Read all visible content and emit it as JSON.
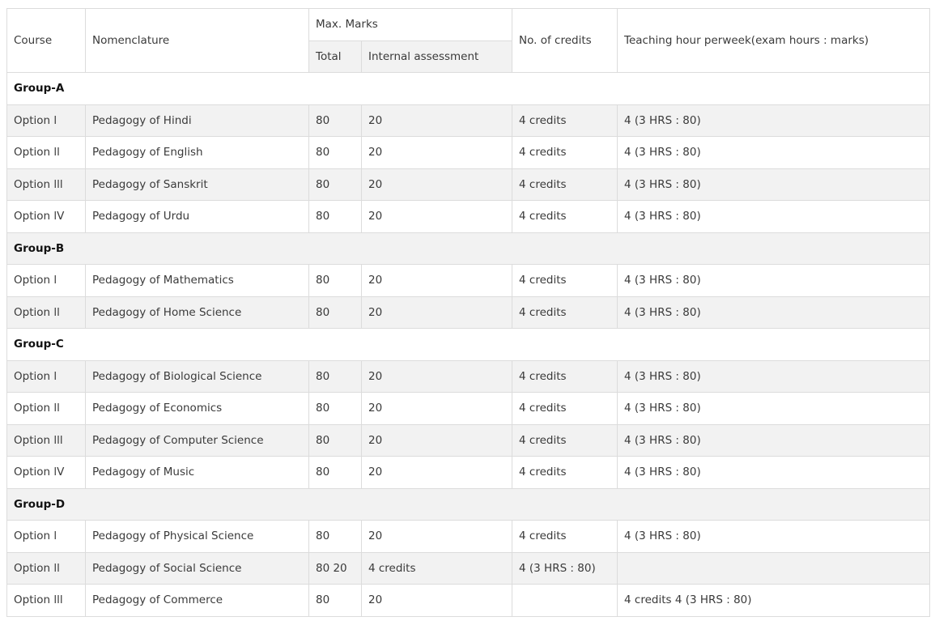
{
  "header": {
    "course": "Course",
    "nomenclature": "Nomenclature",
    "max_marks": "Max. Marks",
    "total": "Total",
    "internal_assessment": "Internal assessment",
    "credits": "No. of credits",
    "teaching": "Teaching hour perweek(exam hours : marks)"
  },
  "rows": [
    {
      "group": "Group-A"
    },
    {
      "course": "Option l",
      "name": "Pedagogy of Hindi",
      "total": "80",
      "ia": "20",
      "credits": "4 credits",
      "teaching": "4 (3 HRS : 80)"
    },
    {
      "course": "Option ll",
      "name": "Pedagogy of English",
      "total": "80",
      "ia": "20",
      "credits": "4 credits",
      "teaching": "4 (3 HRS : 80)"
    },
    {
      "course": "Option lll",
      "name": "Pedagogy of Sanskrit",
      "total": "80",
      "ia": "20",
      "credits": "4 credits",
      "teaching": "4 (3 HRS : 80)"
    },
    {
      "course": "Option lV",
      "name": "Pedagogy of Urdu",
      "total": "80",
      "ia": "20",
      "credits": "4 credits",
      "teaching": "4 (3 HRS : 80)"
    },
    {
      "group": "Group-B"
    },
    {
      "course": "Option l",
      "name": "Pedagogy of Mathematics",
      "total": "80",
      "ia": "20",
      "credits": "4 credits",
      "teaching": "4 (3 HRS : 80)"
    },
    {
      "course": "Option ll",
      "name": "Pedagogy of Home Science",
      "total": "80",
      "ia": "20",
      "credits": "4 credits",
      "teaching": "4 (3 HRS : 80)"
    },
    {
      "group": "Group-C"
    },
    {
      "course": "Option l",
      "name": "Pedagogy of Biological Science",
      "total": "80",
      "ia": "20",
      "credits": "4 credits",
      "teaching": "4 (3 HRS : 80)"
    },
    {
      "course": "Option ll",
      "name": "Pedagogy of Economics",
      "total": "80",
      "ia": "20",
      "credits": "4 credits",
      "teaching": "4 (3 HRS : 80)"
    },
    {
      "course": "Option lll",
      "name": "Pedagogy of Computer Science",
      "total": "80",
      "ia": "20",
      "credits": "4 credits",
      "teaching": "4 (3 HRS : 80)"
    },
    {
      "course": "Option lV",
      "name": "Pedagogy of Music",
      "total": "80",
      "ia": "20",
      "credits": "4 credits",
      "teaching": "4 (3 HRS : 80)"
    },
    {
      "group": "Group-D"
    },
    {
      "course": "Option l",
      "name": "Pedagogy of Physical Science",
      "total": "80",
      "ia": "20",
      "credits": "4 credits",
      "teaching": "4 (3 HRS : 80)"
    },
    {
      "course": "Option ll",
      "name": "Pedagogy of Social Science",
      "total": "80 20",
      "ia": "4 credits",
      "credits": "4 (3 HRS : 80)",
      "teaching": ""
    },
    {
      "course": "Option lll",
      "name": "Pedagogy of Commerce",
      "total": "80",
      "ia": "20",
      "credits": "",
      "teaching": "4 credits 4 (3 HRS : 80)"
    }
  ]
}
